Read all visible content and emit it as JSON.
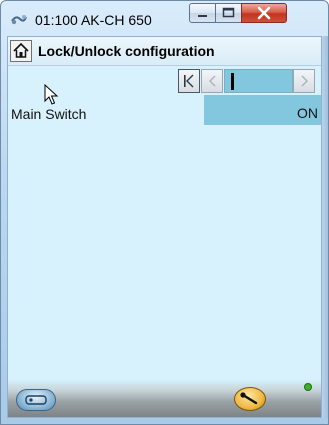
{
  "window": {
    "title": "01:100 AK-CH 650",
    "buttons": {
      "minimize": "minimize-icon",
      "maximize": "maximize-icon",
      "close": "close-icon"
    }
  },
  "header": {
    "home_icon": "home-icon",
    "title": "Lock/Unlock configuration"
  },
  "pager": {
    "first_icon": "first-page-icon",
    "prev_icon": "previous-page-icon",
    "next_icon": "next-page-icon",
    "position": 0
  },
  "rows": [
    {
      "label": "Main Switch",
      "value": "ON"
    }
  ],
  "footer": {
    "left_icon": "device-icon",
    "right_icon": "wrench-icon",
    "status_color": "#3fae2a"
  },
  "colors": {
    "content_bg": "#d7f1fd",
    "value_bg": "#83c7de"
  }
}
